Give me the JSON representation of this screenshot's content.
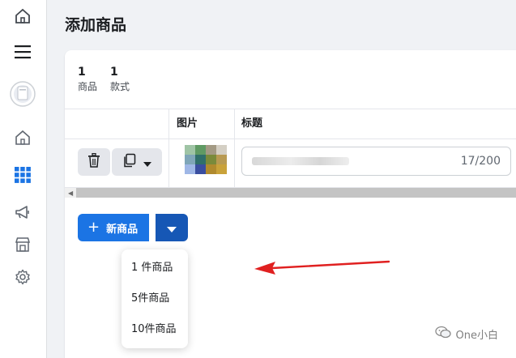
{
  "page": {
    "title": "添加商品"
  },
  "rail": {
    "icons": [
      "home-icon",
      "menu-icon",
      "avatar",
      "home-outline-icon",
      "grid-icon",
      "megaphone-icon",
      "store-icon",
      "gear-icon"
    ],
    "accent": "#1b74e4"
  },
  "stats": [
    {
      "value": "1",
      "label": "商品"
    },
    {
      "value": "1",
      "label": "款式"
    }
  ],
  "table": {
    "columns": [
      "图片",
      "标题"
    ],
    "rows": [
      {
        "title_counter": "17/200"
      }
    ]
  },
  "actions": {
    "new_button_plus": "+",
    "new_button_label": "新商品"
  },
  "dropdown": {
    "items": [
      "1 件商品",
      "5件商品",
      "10件商品"
    ]
  },
  "watermark": {
    "text": "One小白"
  },
  "colors": {
    "primary": "#1b74e4",
    "primary_dark": "#1657b5",
    "annotation_arrow": "#e02020"
  }
}
